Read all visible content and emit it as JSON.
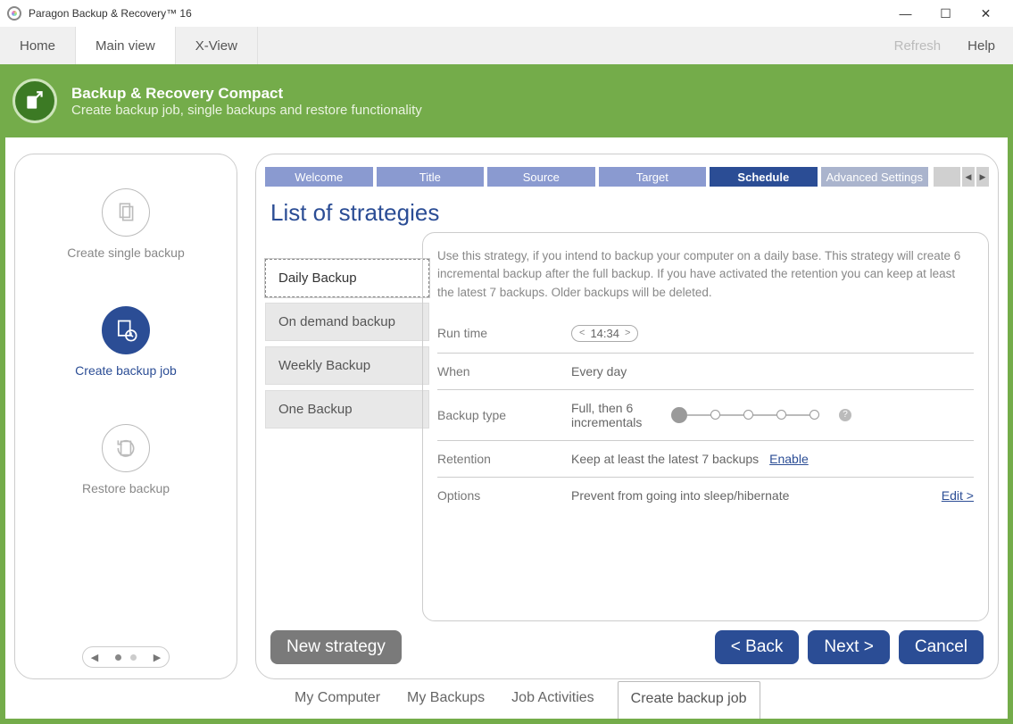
{
  "window": {
    "title": "Paragon Backup & Recovery™ 16"
  },
  "toptabs": {
    "home": "Home",
    "main": "Main view",
    "xview": "X-View",
    "refresh": "Refresh",
    "help": "Help"
  },
  "banner": {
    "title": "Backup & Recovery Compact",
    "subtitle": "Create backup job, single backups and restore functionality"
  },
  "sidebar": {
    "items": [
      {
        "label": "Create single backup"
      },
      {
        "label": "Create backup job"
      },
      {
        "label": "Restore backup"
      }
    ]
  },
  "steps": {
    "items": [
      "Welcome",
      "Title",
      "Source",
      "Target",
      "Schedule"
    ],
    "advanced": "Advanced Settings"
  },
  "heading": "List of strategies",
  "strategies": {
    "items": [
      "Daily Backup",
      "On demand backup",
      "Weekly Backup",
      "One Backup"
    ]
  },
  "detail": {
    "desc": "Use this strategy, if you intend to backup your computer on a daily base. This strategy will create 6 incremental backup after the full backup. If you have activated the retention you can keep at least the latest 7 backups. Older backups will be deleted.",
    "runtime_label": "Run time",
    "runtime_value": "14:34",
    "when_label": "When",
    "when_value": "Every day",
    "backup_type_label": "Backup type",
    "backup_type_value": "Full, then 6 incrementals",
    "retention_label": "Retention",
    "retention_value": "Keep at least the latest 7 backups",
    "retention_link": "Enable",
    "options_label": "Options",
    "options_value": "Prevent from going into sleep/hibernate",
    "options_link": "Edit >"
  },
  "buttons": {
    "new_strategy": "New strategy",
    "back": "< Back",
    "next": "Next >",
    "cancel": "Cancel"
  },
  "bottomtabs": {
    "items": [
      "My Computer",
      "My Backups",
      "Job Activities",
      "Create backup job"
    ]
  }
}
